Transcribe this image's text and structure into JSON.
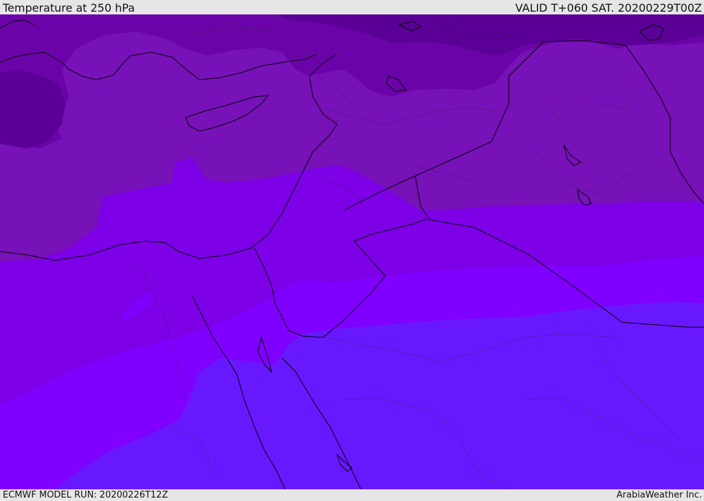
{
  "header": {
    "title": "Temperature at 250 hPa",
    "valid_time": "VALID T+060 SAT. 20200229T00Z"
  },
  "footer": {
    "model_run": "ECMWF MODEL RUN: 20200226T12Z",
    "credit": "ArabiaWeather Inc."
  },
  "colors": {
    "band_coldest": "#5a0096",
    "band_cold": "#6a04a8",
    "band_mid": "#7711b8",
    "band_warm": "#7d00e6",
    "band_warmer": "#8000ff",
    "band_warmest": "#6818ff",
    "coastline": "#000000"
  },
  "map": {
    "field": "temperature",
    "level": "250 hPa",
    "region": "Eastern Mediterranean / Middle East"
  }
}
